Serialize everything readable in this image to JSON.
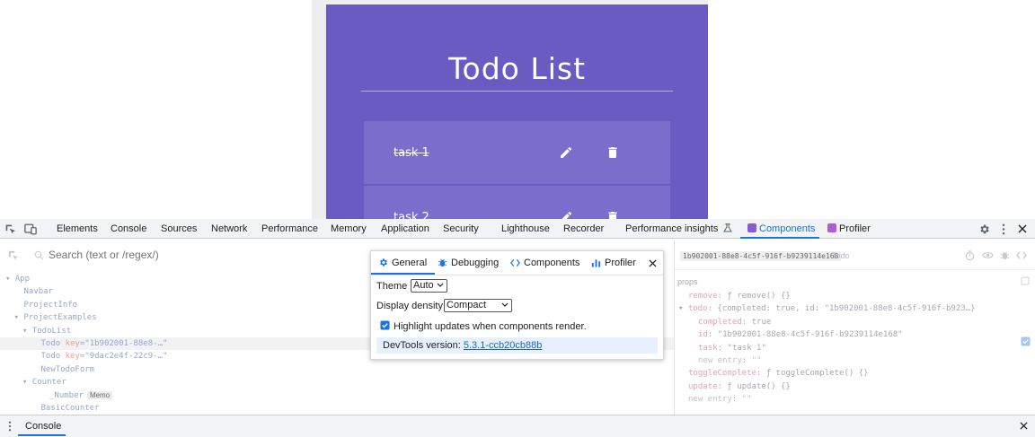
{
  "page": {
    "todo_title": "Todo List",
    "todos": [
      {
        "task": "task 1",
        "completed": true
      },
      {
        "task": "task 2",
        "completed": false
      }
    ]
  },
  "devtools": {
    "tabs": [
      "Elements",
      "Console",
      "Sources",
      "Network",
      "Performance",
      "Memory",
      "Application",
      "Security",
      "Lighthouse",
      "Recorder",
      "Performance insights",
      "Components",
      "Profiler"
    ],
    "active_tab": "Components",
    "search_placeholder": "Search (text or /regex/)",
    "tree": [
      {
        "name": "App",
        "indent": 0,
        "arrow": "▾"
      },
      {
        "name": "Navbar",
        "indent": 1,
        "arrow": ""
      },
      {
        "name": "ProjectInfo",
        "indent": 1,
        "arrow": ""
      },
      {
        "name": "ProjectExamples",
        "indent": 1,
        "arrow": "▾"
      },
      {
        "name": "TodoList",
        "indent": 2,
        "arrow": "▾"
      },
      {
        "name": "Todo",
        "indent": 3,
        "arrow": "",
        "key_label": "key",
        "key_value": "=\"1b902001-88e8-…\"",
        "selected": true
      },
      {
        "name": "Todo",
        "indent": 3,
        "arrow": "",
        "key_label": "key",
        "key_value": "=\"9dac2e4f-22c9-…\""
      },
      {
        "name": "NewTodoForm",
        "indent": 3,
        "arrow": ""
      },
      {
        "name": "Counter",
        "indent": 2,
        "arrow": "▾"
      },
      {
        "name": "_Number",
        "indent": 4,
        "arrow": "",
        "badge": "Memo"
      },
      {
        "name": "BasicCounter",
        "indent": 3,
        "arrow": ""
      }
    ],
    "props_header": {
      "id": "1b902001-88e8-4c5f-916f-b9239114e168",
      "component": "Todo"
    },
    "props_section": "props",
    "props": [
      {
        "key": "remove",
        "sep": ": ",
        "value": "ƒ remove() {}",
        "indent": 1
      },
      {
        "key": "todo",
        "sep": ": ",
        "value": "{completed: true, id: \"1b902001-88e8-4c5f-916f-b923…}",
        "indent": 0,
        "arrow": "▾"
      },
      {
        "key": "completed",
        "sep": ": ",
        "value": "true",
        "indent": 2
      },
      {
        "key": "id",
        "sep": ": ",
        "value": "\"1b902001-88e8-4c5f-916f-b9239114e168\"",
        "indent": 2
      },
      {
        "key": "task",
        "sep": ": ",
        "value": "\"task 1\"",
        "indent": 2
      },
      {
        "key": "new entry",
        "sep": ": ",
        "value": "\"\"",
        "indent": 2,
        "placeholder": true
      },
      {
        "key": "toggleComplete",
        "sep": ": ",
        "value": "ƒ toggleComplete() {}",
        "indent": 1
      },
      {
        "key": "update",
        "sep": ": ",
        "value": "ƒ update() {}",
        "indent": 1
      },
      {
        "key": "new entry",
        "sep": ": ",
        "value": "\"\"",
        "indent": 1,
        "placeholder": true
      }
    ],
    "settings": {
      "tabs": [
        "General",
        "Debugging",
        "Components",
        "Profiler"
      ],
      "active_tab": "General",
      "theme_label": "Theme",
      "theme_value": "Auto",
      "density_label": "Display density",
      "density_value": "Compact",
      "highlight_label": "Highlight updates when components render.",
      "highlight_checked": true,
      "version_label": "DevTools version: ",
      "version_value": "5.3.1-ccb20cb88b"
    },
    "drawer_tab": "Console"
  },
  "colors": {
    "todo_bg": "#6a5bc2",
    "todo_card": "#7b6dcb",
    "accent": "#1a73e8"
  }
}
